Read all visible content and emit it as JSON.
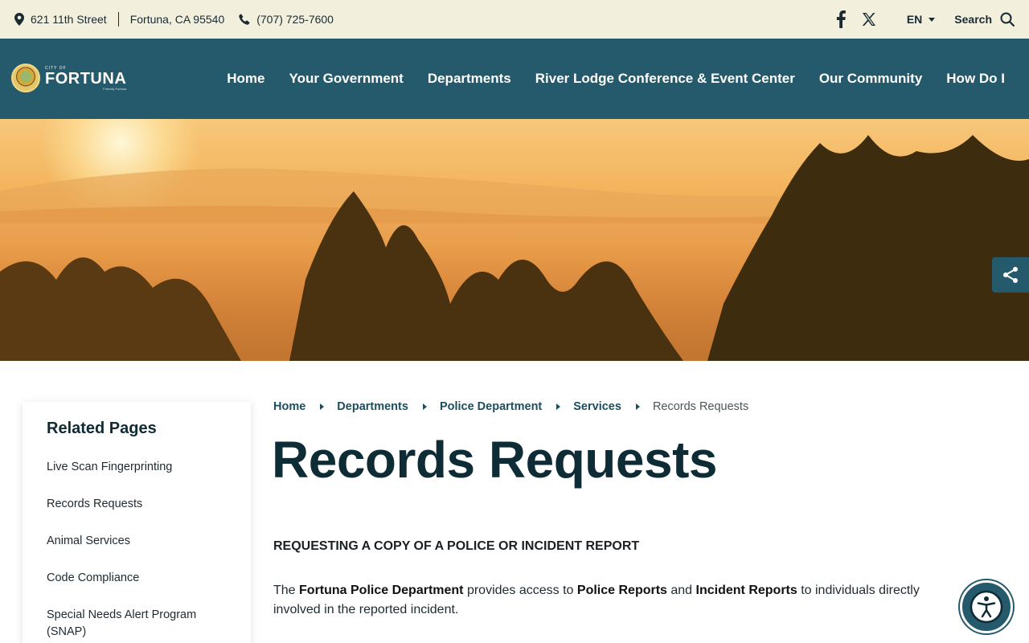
{
  "topbar": {
    "address_street": "621 11th Street",
    "address_city": "Fortuna, CA  95540",
    "phone": "(707) 725-7600",
    "language": "EN",
    "search_label": "Search"
  },
  "logo": {
    "small": "CITY OF",
    "name": "FORTUNA",
    "tagline": "Friendly Fortuna"
  },
  "nav": {
    "items": [
      {
        "label": "Home"
      },
      {
        "label": "Your Government"
      },
      {
        "label": "Departments"
      },
      {
        "label": "River Lodge Conference & Event Center"
      },
      {
        "label": "Our Community"
      },
      {
        "label": "How Do I"
      }
    ]
  },
  "sidebar": {
    "title": "Related Pages",
    "items": [
      {
        "label": "Live Scan Fingerprinting"
      },
      {
        "label": "Records Requests"
      },
      {
        "label": "Animal Services"
      },
      {
        "label": "Code Compliance"
      },
      {
        "label": "Special Needs Alert Program (SNAP)"
      }
    ]
  },
  "breadcrumb": {
    "items": [
      {
        "label": "Home"
      },
      {
        "label": "Departments"
      },
      {
        "label": "Police Department"
      },
      {
        "label": "Services"
      }
    ],
    "current": "Records Requests"
  },
  "main": {
    "title": "Records Requests",
    "section_heading": "REQUESTING A COPY OF A POLICE OR INCIDENT REPORT",
    "para": {
      "t1": "The ",
      "b1": "Fortuna Police Department",
      "t2": " provides access to ",
      "b2": "Police Reports",
      "t3": " and ",
      "b3": "Incident Reports",
      "t4": " to individuals directly involved in the reported incident."
    }
  },
  "colors": {
    "topbar_bg": "#f2f0dc",
    "nav_bg": "#245a6b",
    "title": "#0e2c36",
    "link": "#1b4e5e"
  },
  "icons": {
    "address": "map-pin-icon",
    "phone": "phone-icon",
    "facebook": "facebook-icon",
    "x": "x-twitter-icon",
    "search": "search-icon",
    "share": "share-icon",
    "accessibility": "accessibility-icon"
  }
}
